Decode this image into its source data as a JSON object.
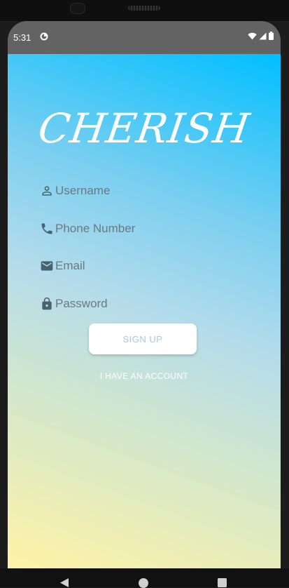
{
  "status_bar": {
    "time": "5:31"
  },
  "app": {
    "logo_text": "CHERISH",
    "fields": {
      "username": {
        "placeholder": "Username",
        "icon": "person-icon"
      },
      "phone": {
        "placeholder": "Phone Number",
        "icon": "phone-icon"
      },
      "email": {
        "placeholder": "Email",
        "icon": "mail-icon"
      },
      "password": {
        "placeholder": "Password",
        "icon": "lock-icon"
      }
    },
    "signup_label": "SIGN UP",
    "account_link_label": "I HAVE AN ACCOUNT"
  },
  "colors": {
    "gradient_top": "#00bfff",
    "gradient_bottom": "#fff3a6",
    "button_text": "#a9c9dc"
  }
}
